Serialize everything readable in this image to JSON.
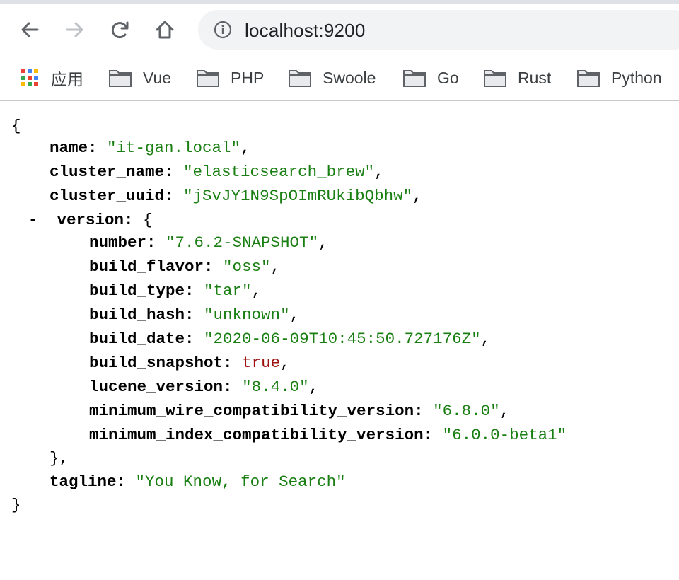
{
  "toolbar": {
    "back_icon": "back-arrow-icon",
    "forward_icon": "forward-arrow-icon",
    "reload_icon": "reload-icon",
    "home_icon": "home-icon",
    "url": "localhost:9200"
  },
  "bookmarks": {
    "apps_label": "应用",
    "items": [
      "Vue",
      "PHP",
      "Swoole",
      "Go",
      "Rust",
      "Python"
    ]
  },
  "json_view": {
    "open_brace": "{",
    "close_brace": "}",
    "name_key": "name:",
    "name_val": "\"it-gan.local\"",
    "cluster_name_key": "cluster_name:",
    "cluster_name_val": "\"elasticsearch_brew\"",
    "cluster_uuid_key": "cluster_uuid:",
    "cluster_uuid_val": "\"jSvJY1N9SpOImRUkibQbhw\"",
    "collapse_toggle": "-",
    "version_key": "version:",
    "version_open": "{",
    "version_close": "},",
    "version": {
      "number_key": "number:",
      "number_val": "\"7.6.2-SNAPSHOT\"",
      "build_flavor_key": "build_flavor:",
      "build_flavor_val": "\"oss\"",
      "build_type_key": "build_type:",
      "build_type_val": "\"tar\"",
      "build_hash_key": "build_hash:",
      "build_hash_val": "\"unknown\"",
      "build_date_key": "build_date:",
      "build_date_val": "\"2020-06-09T10:45:50.727176Z\"",
      "build_snapshot_key": "build_snapshot:",
      "build_snapshot_val": "true",
      "lucene_version_key": "lucene_version:",
      "lucene_version_val": "\"8.4.0\"",
      "min_wire_key": "minimum_wire_compatibility_version:",
      "min_wire_val": "\"6.8.0\"",
      "min_index_key": "minimum_index_compatibility_version:",
      "min_index_val": "\"6.0.0-beta1\""
    },
    "tagline_key": "tagline:",
    "tagline_val": "\"You Know, for Search\""
  }
}
